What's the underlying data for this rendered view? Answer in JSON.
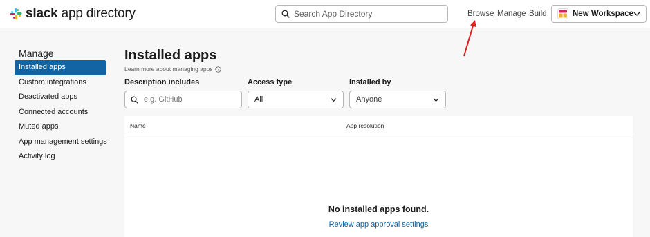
{
  "header": {
    "logo_bold": "slack",
    "logo_rest": " app directory",
    "search_placeholder": "Search App Directory",
    "nav": [
      "Browse",
      "Manage",
      "Build"
    ],
    "workspace": "New Workspace"
  },
  "sidebar": {
    "title": "Manage",
    "items": [
      {
        "label": "Installed apps",
        "active": true
      },
      {
        "label": "Custom integrations"
      },
      {
        "label": "Deactivated apps"
      },
      {
        "label": "Connected accounts"
      },
      {
        "label": "Muted apps"
      },
      {
        "label": "App management settings"
      },
      {
        "label": "Activity log"
      }
    ]
  },
  "main": {
    "title": "Installed apps",
    "learn_more": "Learn more about managing apps",
    "filters": {
      "description_label": "Description includes",
      "description_placeholder": "e.g. GitHub",
      "access_label": "Access type",
      "access_value": "All",
      "installed_by_label": "Installed by",
      "installed_by_value": "Anyone"
    },
    "table": {
      "columns": [
        "Name",
        "App resolution"
      ],
      "empty_title": "No installed apps found.",
      "empty_link": "Review app approval settings"
    }
  },
  "colors": {
    "accent": "#1264a3",
    "annotation_arrow": "#e01e1e"
  }
}
